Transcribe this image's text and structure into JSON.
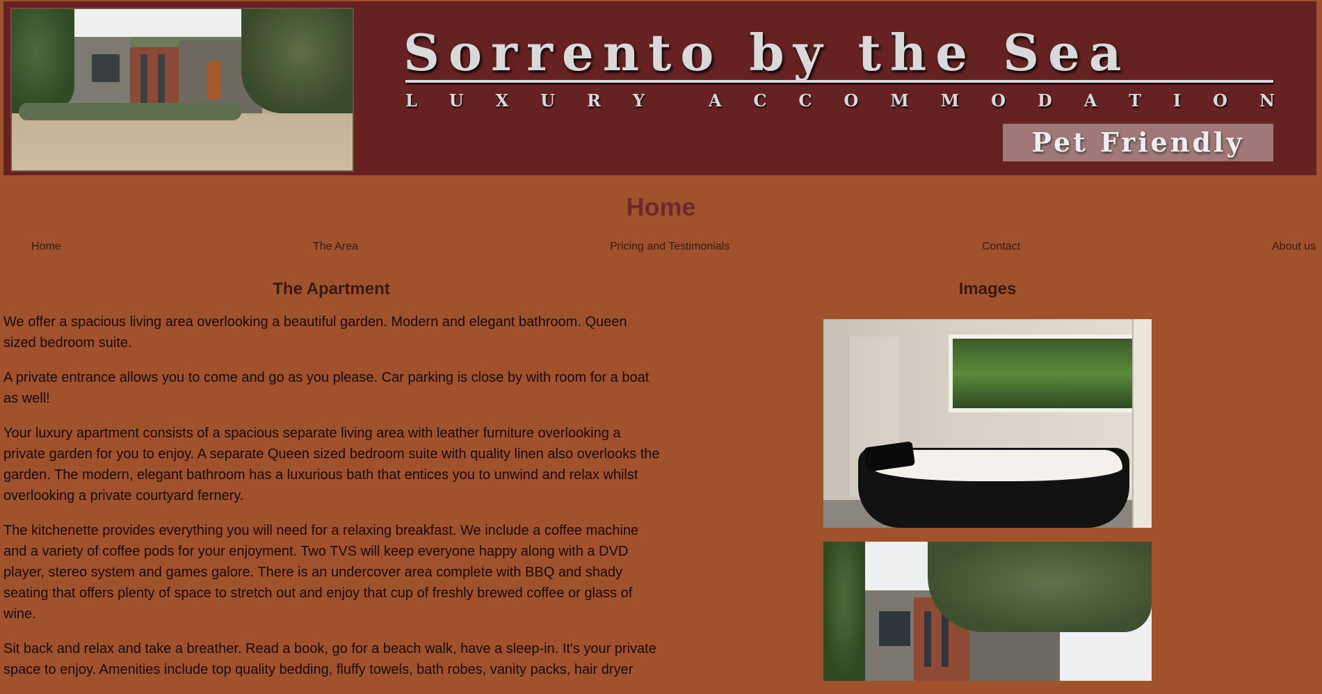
{
  "banner": {
    "title": "Sorrento by the Sea",
    "subtitle_letters": [
      "L",
      "U",
      "X",
      "U",
      "R",
      "Y",
      "",
      "A",
      "C",
      "C",
      "O",
      "M",
      "M",
      "O",
      "D",
      "A",
      "T",
      "I",
      "O",
      "N"
    ],
    "badge": "Pet Friendly"
  },
  "page": {
    "title": "Home"
  },
  "nav": {
    "items": [
      {
        "label": "Home"
      },
      {
        "label": "The Area"
      },
      {
        "label": "Pricing and Testimonials"
      },
      {
        "label": "Contact"
      },
      {
        "label": "About us"
      }
    ]
  },
  "apartment": {
    "heading": "The Apartment",
    "paragraphs": [
      "We offer a spacious living area overlooking a beautiful garden. Modern and elegant bathroom. Queen sized bedroom suite.",
      "A private entrance allows you to come and go as you please. Car parking is close by with room for a boat as well!",
      "Your luxury apartment consists of a spacious separate living area with leather furniture overlooking a private garden for you to enjoy. A separate Queen sized bedroom suite with quality linen also overlooks the garden. The modern, elegant bathroom has a luxurious bath that entices you to unwind and relax whilst overlooking a private courtyard fernery.",
      "The kitchenette provides everything you will need for a relaxing breakfast. We include a coffee machine and a variety of coffee pods for your enjoyment. Two TVS will keep everyone happy along with a DVD player, stereo system and games galore. There is an undercover area complete with BBQ and shady seating that offers plenty of space to stretch out and enjoy that cup of freshly brewed coffee or glass of wine.",
      "Sit back and relax and take a breather. Read a book, go for a beach walk, have a sleep-in. It's your private space to enjoy. Amenities include top quality bedding, fluffy towels, bath robes, vanity packs, hair dryer"
    ]
  },
  "images": {
    "heading": "Images"
  }
}
